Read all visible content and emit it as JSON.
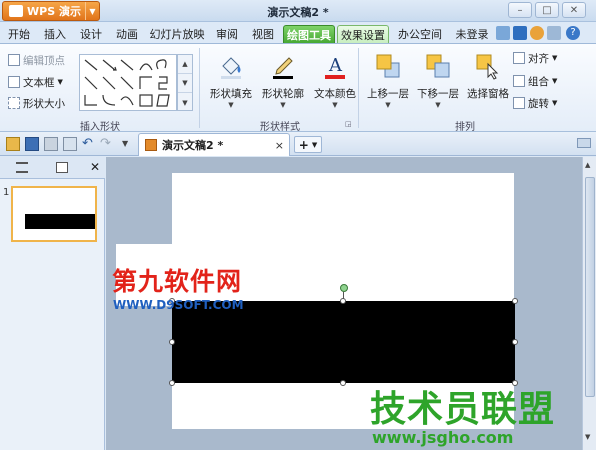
{
  "app": {
    "menu_label": "WPS 演示",
    "window_title": "演示文稿2 *"
  },
  "tabs": [
    "开始",
    "插入",
    "设计",
    "动画",
    "幻灯片放映",
    "审阅",
    "视图",
    "绘图工具",
    "效果设置",
    "办公空间"
  ],
  "account": {
    "login_label": "未登录"
  },
  "ribbon": {
    "insert_shape": {
      "edit_points": "编辑顶点",
      "text_box": "文本框",
      "shape_size": "形状大小",
      "group_label": "插入形状"
    },
    "shape_style": {
      "fill": "形状填充",
      "outline": "形状轮廓",
      "text_color": "文本颜色",
      "group_label": "形状样式"
    },
    "arrange": {
      "bring_forward": "上移一层",
      "send_backward": "下移一层",
      "selection_pane": "选择窗格",
      "align": "对齐",
      "group": "组合",
      "rotate": "旋转",
      "group_label": "排列"
    }
  },
  "doc_tab": {
    "name": "演示文稿2 *",
    "close": "×"
  },
  "slides": {
    "thumb_number": "1"
  },
  "watermarks": {
    "site1_name": "第九软件网",
    "site1_url": "WWW.D9SOFT.COM",
    "site2_name": "技术员联盟",
    "site2_url": "www.jsgho.com"
  },
  "colors": {
    "accent_orange": "#e1741a",
    "draw_tab_green": "#47a834",
    "thumb_border": "#f0b44a",
    "shape_fill": "#000000"
  }
}
